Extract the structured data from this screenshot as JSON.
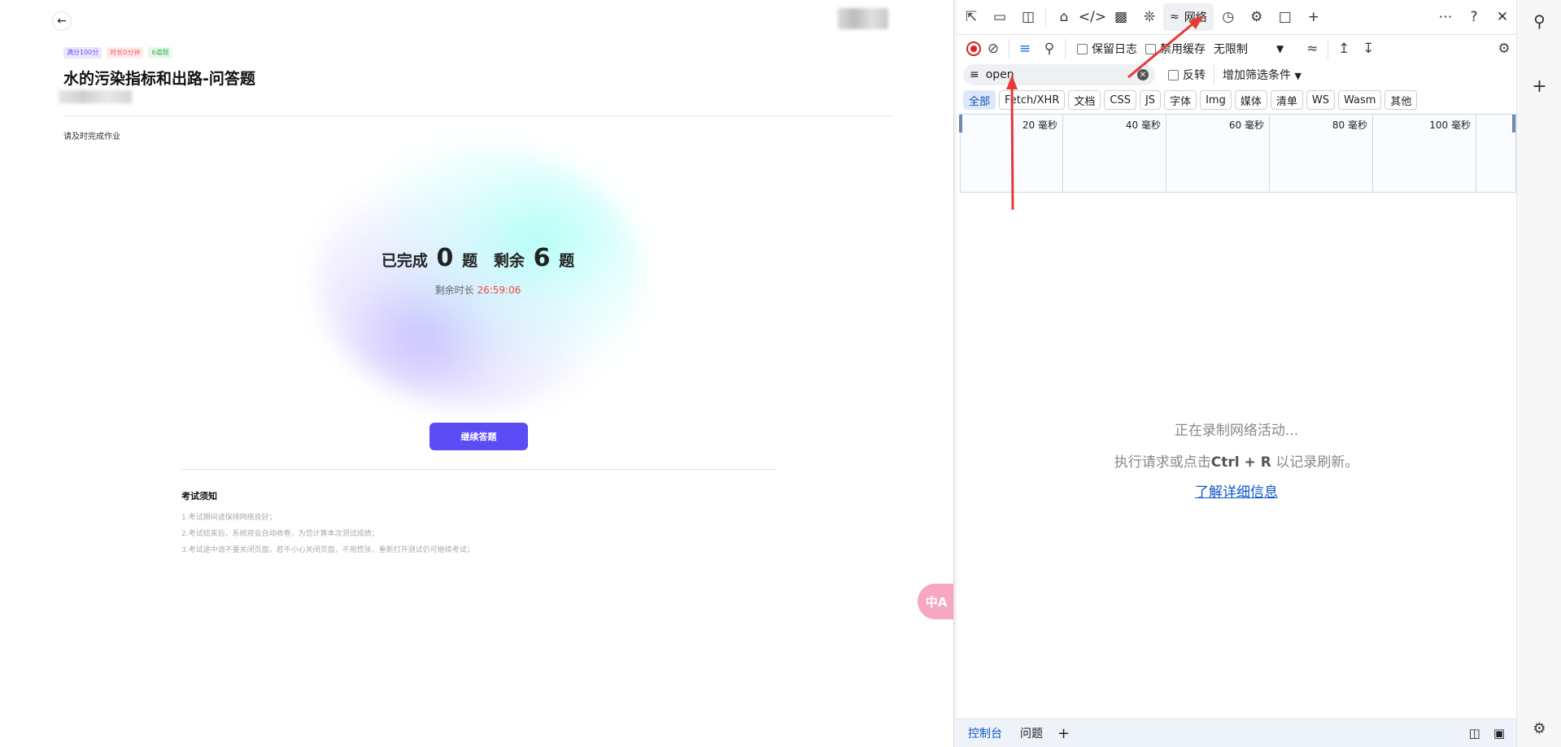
{
  "page": {
    "back_icon": "arrow-left-icon",
    "tags": [
      "满分100分",
      "时长0分钟",
      "6道题"
    ],
    "title": "水的污染指标和出路-问答题",
    "description": "请及时完成作业",
    "status": {
      "completed_label": "已完成",
      "completed_count": "0",
      "question_unit_1": "题",
      "remaining_label": "剩余",
      "remaining_count": "6",
      "question_unit_2": "题"
    },
    "time_left_label": "剩余时长",
    "time_left_value": "26:59:06",
    "continue_button": "继续答题",
    "notes_title": "考试须知",
    "notes": [
      "1.考试期间请保持网络良好；",
      "2.考试结束后，系统将会自动收卷，为您计算本次测试成绩；",
      "3.考试途中请不要关闭页面，若不小心关闭页面，不用慌张，重新打开测试仍可继续考试；"
    ],
    "translate_icon": "translate-icon",
    "colors": {
      "accent": "#5b4cf5",
      "time": "#f0483e"
    }
  },
  "devtools": {
    "network_tab_label": "网络",
    "preserve_log_label": "保留日志",
    "disable_cache_label": "禁用缓存",
    "throttle_label": "无限制",
    "filter_value": "open",
    "invert_label": "反转",
    "more_filters_label": "增加筛选条件",
    "type_filters": [
      "全部",
      "Fetch/XHR",
      "文档",
      "CSS",
      "JS",
      "字体",
      "Img",
      "媒体",
      "清单",
      "WS",
      "Wasm",
      "其他"
    ],
    "timeline_ticks": [
      "20 毫秒",
      "40 毫秒",
      "60 毫秒",
      "80 毫秒",
      "100 毫秒"
    ],
    "empty_line1": "正在录制网络活动...",
    "empty_line2_prefix": "执行请求或点击",
    "empty_line2_keys": "Ctrl + R",
    "empty_line2_suffix": "以记录刷新。",
    "learn_more": "了解详细信息",
    "drawer_tabs": [
      "控制台",
      "问题"
    ]
  }
}
